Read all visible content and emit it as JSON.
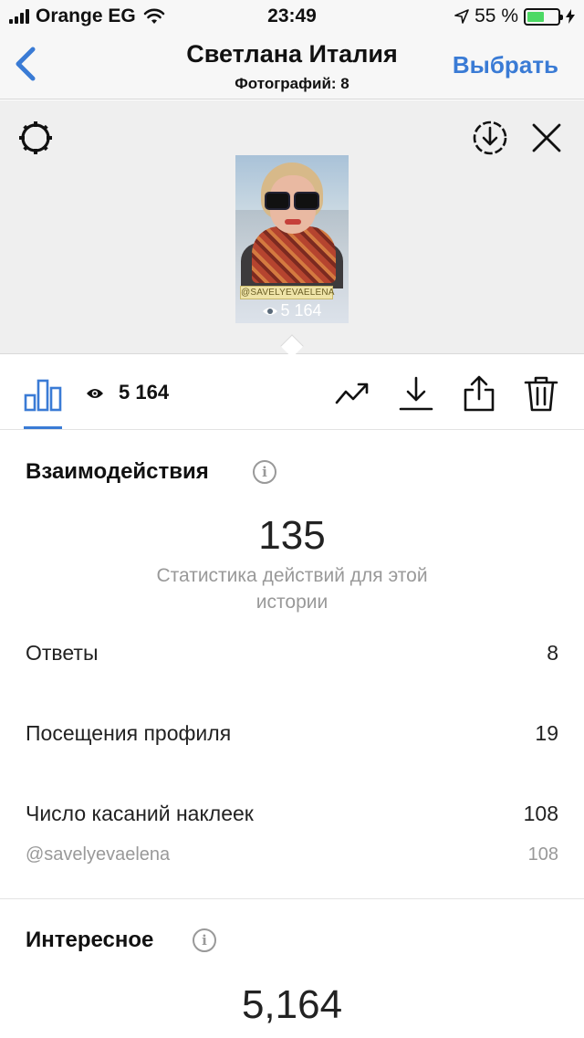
{
  "status_bar": {
    "carrier": "Orange EG",
    "time": "23:49",
    "battery_percent": "55 %",
    "battery_level": 0.55
  },
  "nav": {
    "title": "Светлана Италия",
    "subtitle": "Фотографий: 8",
    "select_label": "Выбрать"
  },
  "story": {
    "mention": "@SAVELYEVAELENA",
    "views_label": "5 164"
  },
  "toolbar": {
    "views_count": "5 164"
  },
  "interactions": {
    "title": "Взаимодействия",
    "info": "i",
    "total": "135",
    "caption": "Статистика действий для этой истории",
    "rows": [
      {
        "label": "Ответы",
        "value": "8"
      },
      {
        "label": "Посещения профиля",
        "value": "19"
      },
      {
        "label": "Число касаний наклеек",
        "value": "108"
      }
    ],
    "sticker_sub": {
      "label": "@savelyevaelena",
      "value": "108"
    }
  },
  "interesting": {
    "title": "Интересное",
    "info": "i",
    "total": "5,164"
  },
  "colors": {
    "accent": "#3a7bd5",
    "battery": "#4cd964"
  }
}
